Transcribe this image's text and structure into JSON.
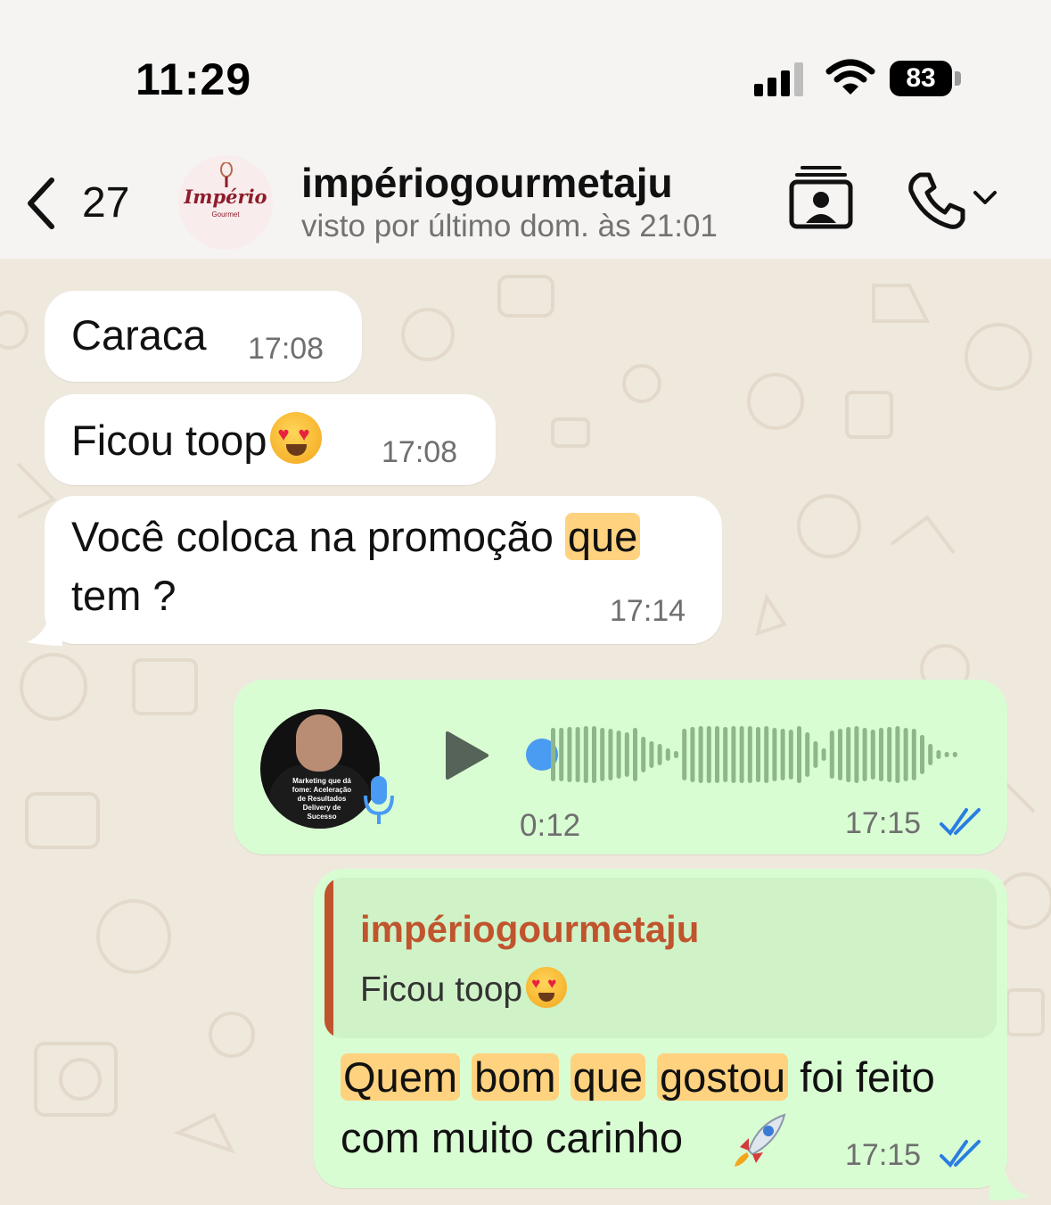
{
  "status_bar": {
    "time": "11:29",
    "battery": "83"
  },
  "header": {
    "back_count": "27",
    "contact_name": "impériogourmetaju",
    "last_seen": "visto por último dom. às 21:01",
    "avatar_text": "Império",
    "avatar_subtext": "Gourmet"
  },
  "messages": [
    {
      "direction": "in",
      "text": "Caraca",
      "time": "17:08"
    },
    {
      "direction": "in",
      "text": "Ficou toop",
      "emoji": "heart-eyes",
      "time": "17:08"
    },
    {
      "direction": "in",
      "text_parts": [
        "Você coloca na promoção ",
        "que",
        "tem ?"
      ],
      "highlighted": [
        "que"
      ],
      "time": "17:14"
    },
    {
      "direction": "out",
      "type": "voice",
      "duration": "0:12",
      "time": "17:15",
      "status": "read",
      "shirt_text": "Marketing que dá fome: Aceleração de Resultados Delivery de Sucesso"
    },
    {
      "direction": "out",
      "type": "reply",
      "quote": {
        "author": "impériogourmetaju",
        "text": "Ficou toop",
        "emoji": "heart-eyes"
      },
      "words": [
        "Quem",
        "bom",
        "que",
        "gostou",
        "foi feito",
        "com muito carinho"
      ],
      "highlighted": [
        "Quem",
        "bom",
        "que",
        "gostou"
      ],
      "emoji": "rocket",
      "time": "17:15",
      "status": "read"
    }
  ],
  "colors": {
    "incoming_bubble": "#ffffff",
    "outgoing_bubble": "#d9fdd3",
    "highlight": "#ffd27f",
    "read_ticks": "#2a7de1",
    "quote_author": "#c0542d",
    "wallpaper": "#efe8dd"
  },
  "icons": [
    "back-chevron-icon",
    "signal-icon",
    "wifi-icon",
    "battery-icon",
    "contact-card-icon",
    "phone-icon",
    "chevron-down-icon",
    "play-icon",
    "mic-icon",
    "read-ticks-icon",
    "heart-eyes-emoji",
    "rocket-emoji"
  ]
}
